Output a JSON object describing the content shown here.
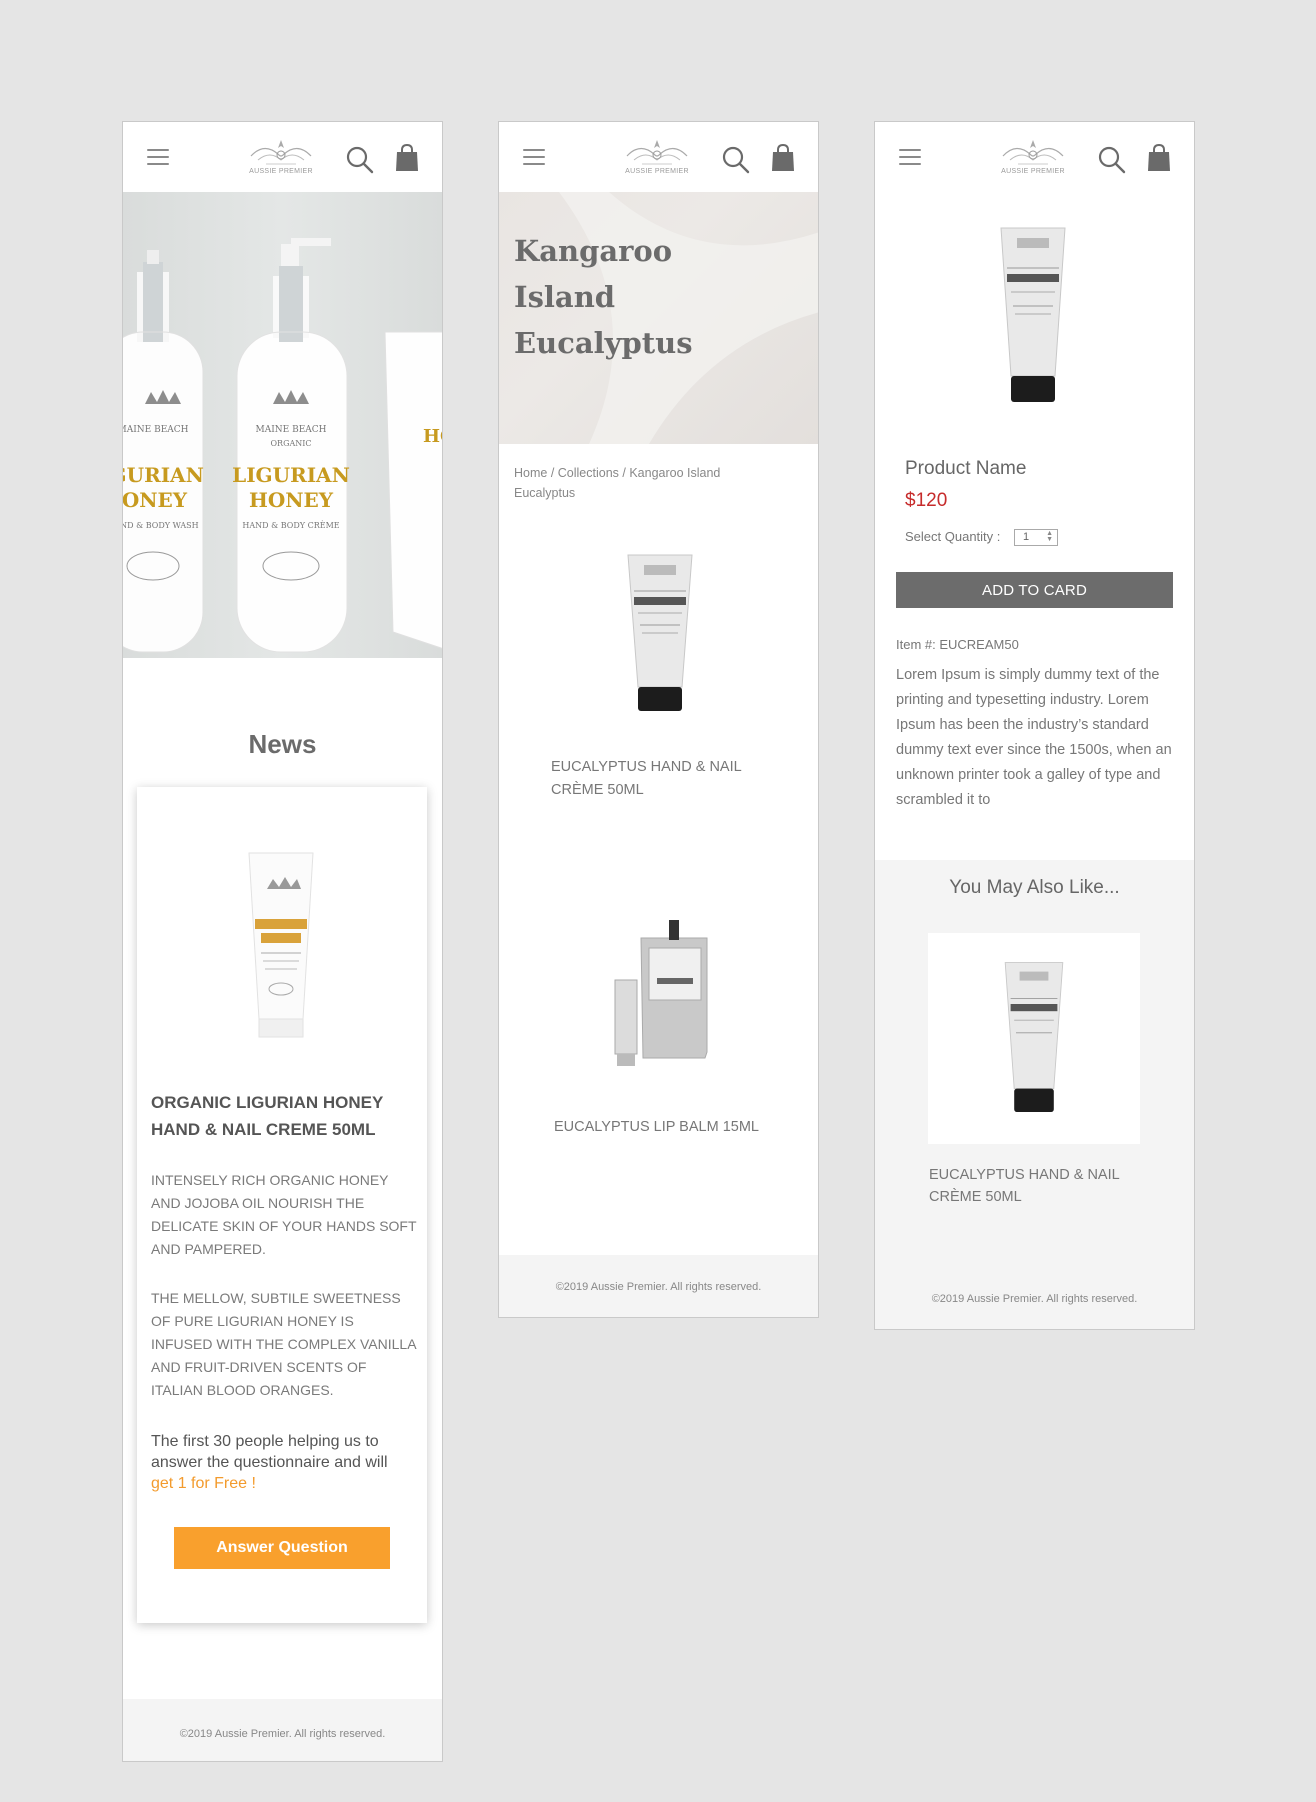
{
  "brand": {
    "logo_text": "AUSSIE PREMIER",
    "accent_orange": "#f9a02d",
    "price_red": "#c62b2b",
    "button_gray": "#6c6c6c"
  },
  "icons": {
    "menu": "hamburger-icon",
    "search": "search-icon",
    "cart": "shopping-bag-icon"
  },
  "footer_text": "©2019 Aussie Premier. All rights reserved.",
  "home": {
    "hero_labels": [
      "MAINE BEACH",
      "ORGANIC",
      "LIGURIAN",
      "HONEY",
      "HAND & BODY WASH",
      "HAND & BODY CRÈME"
    ],
    "news_title": "News",
    "card": {
      "product_title": "ORGANIC LIGURIAN HONEY HAND & NAIL CREME 50ML",
      "desc_1": "INTENSELY RICH ORGANIC HONEY AND JOJOBA OIL NOURISH THE DELICATE SKIN OF YOUR HANDS SOFT AND PAMPERED.",
      "desc_2": "THE MELLOW, SUBTILE SWEETNESS OF PURE LIGURIAN HONEY IS INFUSED WITH THE COMPLEX VANILLA AND FRUIT-DRIVEN SCENTS OF ITALIAN BLOOD ORANGES.",
      "promo_text": "The first 30 people helping us to answer the questionnaire and will ",
      "promo_highlight": "get 1 for Free !",
      "button_label": "Answer Question"
    }
  },
  "collection": {
    "hero_title": "Kangaroo Island Eucalyptus",
    "breadcrumb": {
      "home": "Home",
      "sep": " / ",
      "collections": "Collections",
      "current": "Kangaroo Island Eucalyptus"
    },
    "products": [
      {
        "name": "EUCALYPTUS HAND & NAIL CRÈME 50ML"
      },
      {
        "name": "EUCALYPTUS LIP BALM 15ML"
      }
    ]
  },
  "product": {
    "name": "Product Name",
    "price": "$120",
    "qty_label": "Select Quantity :",
    "qty_value": "1",
    "add_button": "ADD TO CARD",
    "item_number": "Item #: EUCREAM50",
    "description": "Lorem Ipsum is simply dummy text of the printing and typesetting industry. Lorem Ipsum has been the industry’s standard dummy text ever since the 1500s, when an unknown printer took a galley of type and scrambled it to",
    "also_like_title": "You May Also Like...",
    "also_like_item": "EUCALYPTUS HAND & NAIL CRÈME 50ML"
  }
}
